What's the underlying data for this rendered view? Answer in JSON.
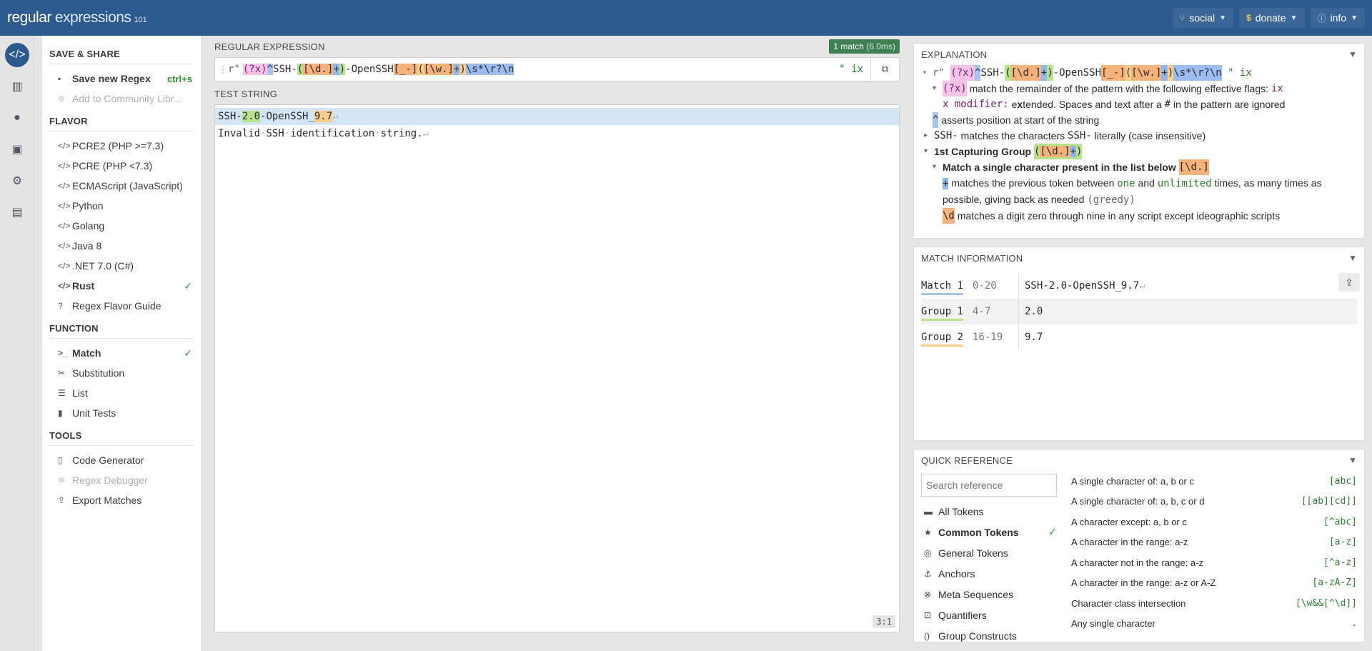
{
  "topbar": {
    "logo_main": "regular",
    "logo_second": "expressions",
    "logo_sub": "101",
    "buttons": [
      {
        "label": "social",
        "icon": "social-icon"
      },
      {
        "label": "donate",
        "icon": "donate-icon"
      },
      {
        "label": "info",
        "icon": "info-icon"
      }
    ]
  },
  "sidebar": {
    "save_share_title": "SAVE & SHARE",
    "save_new": "Save new Regex",
    "save_shortcut": "ctrl+s",
    "add_library": "Add to Community Libr...",
    "flavor_title": "FLAVOR",
    "flavors": [
      "PCRE2 (PHP >=7.3)",
      "PCRE (PHP <7.3)",
      "ECMAScript (JavaScript)",
      "Python",
      "Golang",
      "Java 8",
      ".NET 7.0 (C#)",
      "Rust"
    ],
    "flavor_guide": "Regex Flavor Guide",
    "function_title": "FUNCTION",
    "functions": [
      "Match",
      "Substitution",
      "List",
      "Unit Tests"
    ],
    "tools_title": "TOOLS",
    "tools": [
      "Code Generator",
      "Regex Debugger",
      "Export Matches"
    ]
  },
  "main": {
    "regex_label": "REGULAR EXPRESSION",
    "match_badge": "1 match",
    "match_time": "(6.0ms)",
    "regex_delim": "r\"",
    "regex_end": "\"",
    "regex_flags": "ix",
    "test_label": "TEST STRING",
    "test_lines": [
      "SSH-2.0-OpenSSH_9.7",
      "Invalid SSH identification string."
    ],
    "position": "3:1"
  },
  "explanation": {
    "title": "EXPLANATION",
    "lines": {
      "flags_desc": "match the remainder of the pattern with the following effective flags:",
      "flags_val": "ix",
      "x_modifier": "x modifier:",
      "x_desc_1": "e",
      "x_desc_2": "x",
      "x_desc_3": "tended. Spaces and text after a",
      "x_desc_hash": "#",
      "x_desc_4": "in the pattern are ignored",
      "anchor_desc": "asserts position at start of the string",
      "ssh_tok": "SSH-",
      "ssh_desc_1": "matches the characters",
      "ssh_desc_2": "literally (case insensitive)",
      "group1_title": "1st Capturing Group",
      "match_single": "Match a single character present in the list below",
      "plus_desc_1": "matches the previous token between",
      "plus_one": "one",
      "plus_and": "and",
      "plus_unlimited": "unlimited",
      "plus_desc_2": "times, as many times as",
      "plus_desc_3": "possible, giving back as needed",
      "plus_greedy": "(greedy)",
      "d_desc": "matches a digit zero through nine in any script except ideographic scripts"
    }
  },
  "match_info": {
    "title": "MATCH INFORMATION",
    "rows": [
      {
        "label": "Match 1",
        "range": "0-20",
        "value": "SSH-2.0-OpenSSH_9.7"
      },
      {
        "label": "Group 1",
        "range": "4-7",
        "value": "2.0"
      },
      {
        "label": "Group 2",
        "range": "16-19",
        "value": "9.7"
      }
    ]
  },
  "quick_ref": {
    "title": "QUICK REFERENCE",
    "search_placeholder": "Search reference",
    "categories": [
      "All Tokens",
      "Common Tokens",
      "General Tokens",
      "Anchors",
      "Meta Sequences",
      "Quantifiers",
      "Group Constructs"
    ],
    "items": [
      {
        "desc": "A single character of: a, b or c",
        "token": "[abc]"
      },
      {
        "desc": "A single character of: a, b, c or d",
        "token": "[[ab][cd]]"
      },
      {
        "desc": "A character except: a, b or c",
        "token": "[^abc]"
      },
      {
        "desc": "A character in the range: a-z",
        "token": "[a-z]"
      },
      {
        "desc": "A character not in the range: a-z",
        "token": "[^a-z]"
      },
      {
        "desc": "A character in the range: a-z or A-Z",
        "token": "[a-zA-Z]"
      },
      {
        "desc": "Character class intersection",
        "token": "[\\w&&[^\\d]]"
      },
      {
        "desc": "Any single character",
        "token": "."
      }
    ]
  }
}
